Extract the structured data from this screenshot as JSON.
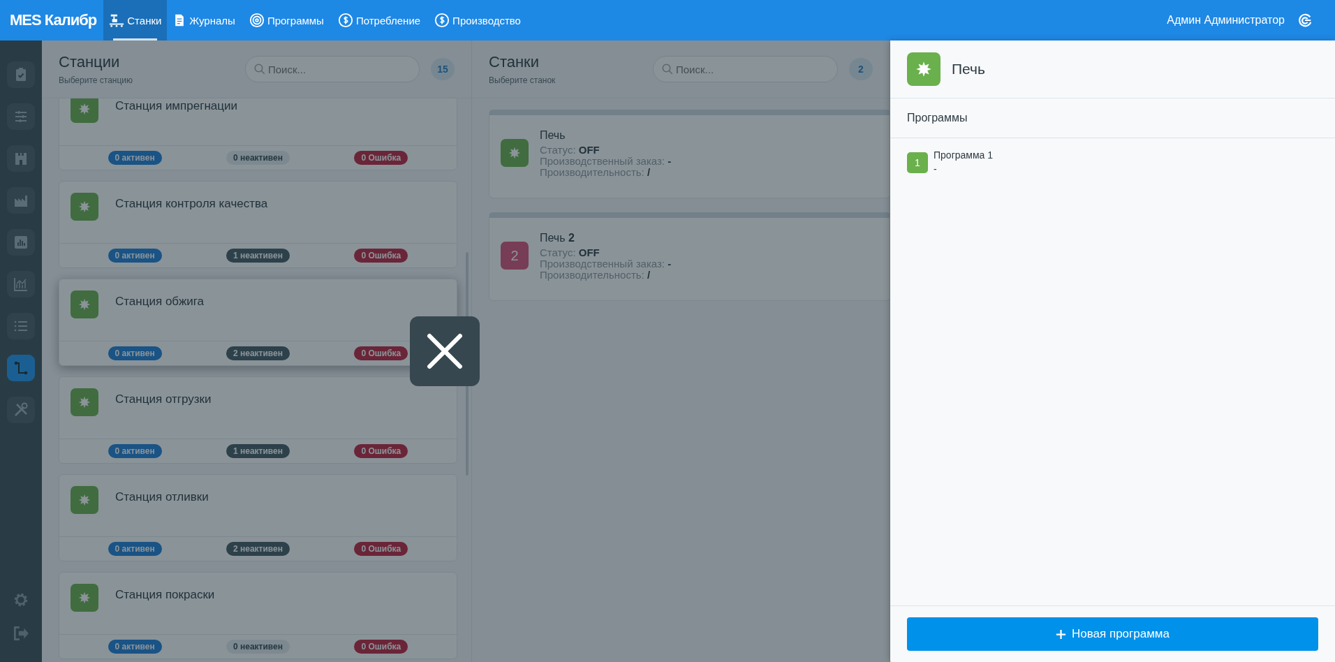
{
  "topbar": {
    "logo": "MES Калибр",
    "nav": [
      {
        "label": "Станки",
        "selected": true
      },
      {
        "label": "Журналы",
        "selected": false
      },
      {
        "label": "Программы",
        "selected": false
      },
      {
        "label": "Потребление",
        "selected": false
      },
      {
        "label": "Производство",
        "selected": false
      }
    ],
    "user": "Админ Администратор"
  },
  "sidebar": {
    "items": [
      {
        "selected": false
      },
      {
        "selected": false
      },
      {
        "selected": false
      },
      {
        "selected": false
      },
      {
        "selected": false
      },
      {
        "selected": false
      },
      {
        "selected": false
      },
      {
        "selected": true
      },
      {
        "selected": false
      }
    ]
  },
  "stations": {
    "title": "Станции",
    "subtitle": "Выберите станцию",
    "search": {
      "placeholder": "Поиск..."
    },
    "count": "15",
    "items": [
      {
        "name": "Станция импрегнации",
        "selected": false,
        "badges": [
          {
            "kind": "active",
            "label": "0 активен",
            "muted": false
          },
          {
            "kind": "inactive",
            "label": "0 неактивен",
            "muted": true
          },
          {
            "kind": "error",
            "label": "0 Ошибка",
            "muted": false
          }
        ]
      },
      {
        "name": "Станция контроля качества",
        "selected": false,
        "badges": [
          {
            "kind": "active",
            "label": "0 активен",
            "muted": false
          },
          {
            "kind": "inactive",
            "label": "1 неактивен",
            "muted": false
          },
          {
            "kind": "error",
            "label": "0 Ошибка",
            "muted": false
          }
        ]
      },
      {
        "name": "Станция обжига",
        "selected": true,
        "badges": [
          {
            "kind": "active",
            "label": "0 активен",
            "muted": false
          },
          {
            "kind": "inactive",
            "label": "2 неактивен",
            "muted": false
          },
          {
            "kind": "error",
            "label": "0 Ошибка",
            "muted": false
          }
        ]
      },
      {
        "name": "Станция отгрузки",
        "selected": false,
        "badges": [
          {
            "kind": "active",
            "label": "0 активен",
            "muted": false
          },
          {
            "kind": "inactive",
            "label": "1 неактивен",
            "muted": false
          },
          {
            "kind": "error",
            "label": "0 Ошибка",
            "muted": false
          }
        ]
      },
      {
        "name": "Станция отливки",
        "selected": false,
        "badges": [
          {
            "kind": "active",
            "label": "0 активен",
            "muted": false
          },
          {
            "kind": "inactive",
            "label": "2 неактивен",
            "muted": false
          },
          {
            "kind": "error",
            "label": "0 Ошибка",
            "muted": false
          }
        ]
      },
      {
        "name": "Станция покраски",
        "selected": false,
        "badges": [
          {
            "kind": "active",
            "label": "0 активен",
            "muted": false
          },
          {
            "kind": "inactive",
            "label": "0 неактивен",
            "muted": true
          },
          {
            "kind": "error",
            "label": "0 Ошибка",
            "muted": false
          }
        ]
      }
    ]
  },
  "machines": {
    "title": "Станки",
    "subtitle": "Выберите станок",
    "search": {
      "placeholder": "Поиск..."
    },
    "count": "2",
    "items": [
      {
        "name": "Печь",
        "icon": {
          "kind": "star"
        },
        "lines": [
          "Статус: **OFF**",
          "Производственный заказ: **-**",
          "Производительность: **/**"
        ]
      },
      {
        "name": "Печь **2**",
        "icon": {
          "kind": "text",
          "label": "2"
        },
        "lines": [
          "Статус: **OFF**",
          "Производственный заказ: **-**",
          "Производительность: **/**"
        ]
      }
    ]
  },
  "drawer": {
    "title": "Печь",
    "section": "Программы",
    "programs": [
      {
        "number": "1",
        "name": "Программа 1",
        "description": "-"
      }
    ],
    "button": "Новая программа"
  }
}
